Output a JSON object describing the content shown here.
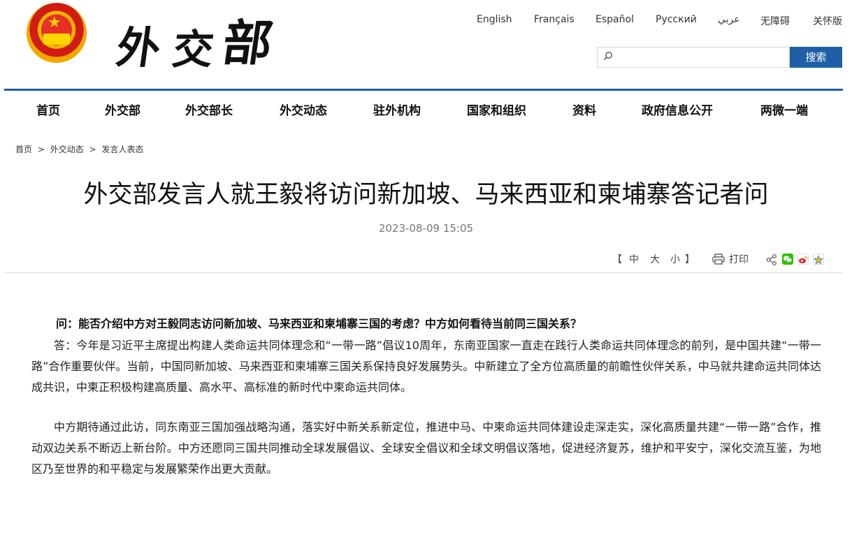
{
  "header": {
    "logo_text": "外交部",
    "languages": [
      "English",
      "Français",
      "Español",
      "Русский",
      "عربي",
      "无障碍",
      "关怀版"
    ],
    "search": {
      "placeholder": "",
      "button_label": "搜索"
    }
  },
  "nav": {
    "items": [
      "首页",
      "外交部",
      "外交部长",
      "外交动态",
      "驻外机构",
      "国家和组织",
      "资料",
      "政府信息公开",
      "两微一端"
    ]
  },
  "breadcrumb": [
    "首页",
    ">",
    "外交动态",
    ">",
    "发言人表态"
  ],
  "article": {
    "title": "外交部发言人就王毅将访问新加坡、马来西亚和柬埔寨答记者问",
    "date": "2023-08-09 15:05",
    "font_size_controls": {
      "open": "【",
      "large": "中",
      "medium": "大",
      "small": "小",
      "close": "】"
    },
    "print_label": "打印",
    "question": "问：能否介绍中方对王毅同志访问新加坡、马来西亚和柬埔寨三国的考虑？中方如何看待当前同三国关系？",
    "paragraphs": [
      "答：今年是习近平主席提出构建人类命运共同体理念和“一带一路”倡议10周年，东南亚国家一直走在践行人类命运共同体理念的前列，是中国共建“一带一路”合作重要伙伴。当前，中国同新加坡、马来西亚和柬埔寨三国关系保持良好发展势头。中新建立了全方位高质量的前瞻性伙伴关系，中马就共建命运共同体达成共识，中柬正积极构建高质量、高水平、高标准的新时代中柬命运共同体。",
      "中方期待通过此访，同东南亚三国加强战略沟通，落实好中新关系新定位，推进中马、中柬命运共同体建设走深走实，深化高质量共建“一带一路”合作，推动双边关系不断迈上新台阶。中方还愿同三国共同推动全球发展倡议、全球安全倡议和全球文明倡议落地，促进经济复苏，维护和平安宁，深化交流互鉴，为地区乃至世界的和平稳定与发展繁荣作出更大贡献。"
    ]
  },
  "colors": {
    "accent": "#1f5fa6",
    "emblem_red": "#d01c12",
    "emblem_gold": "#f2b400"
  },
  "icons": [
    "national-emblem",
    "search-icon",
    "printer-icon",
    "share-icon",
    "wechat-icon",
    "weibo-icon",
    "qzone-icon"
  ]
}
